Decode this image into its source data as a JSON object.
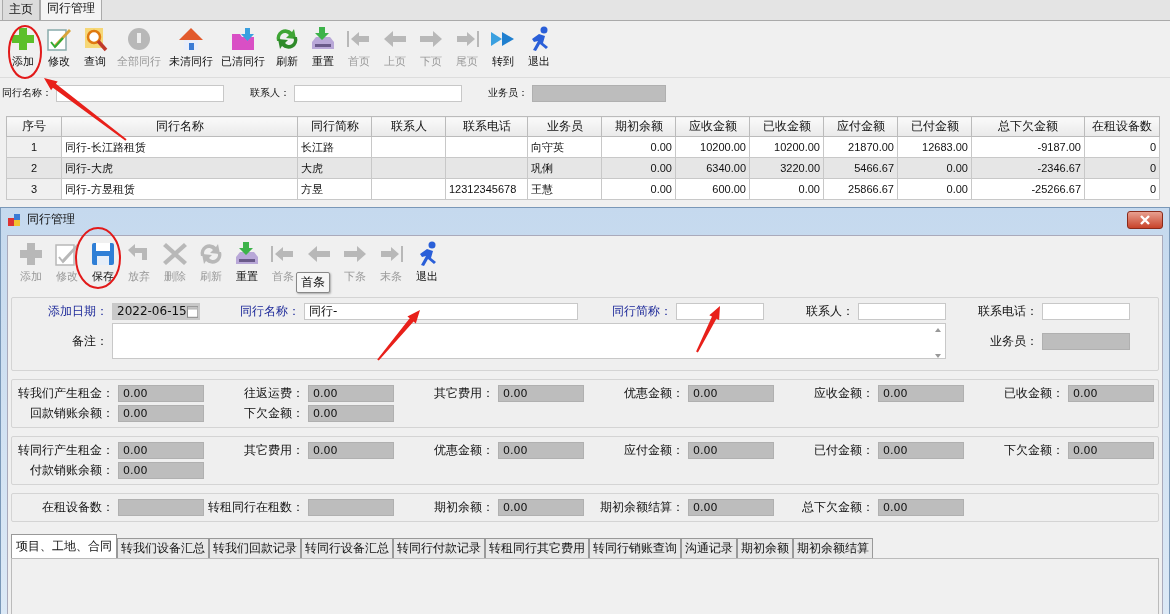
{
  "top_tabs": [
    {
      "label": "主页",
      "selected": false
    },
    {
      "label": "同行管理",
      "selected": true
    }
  ],
  "toolbar": [
    {
      "label": "添加",
      "disabled": false
    },
    {
      "label": "修改",
      "disabled": false
    },
    {
      "label": "查询",
      "disabled": false
    },
    {
      "label": "全部同行",
      "disabled": true
    },
    {
      "label": "未清同行",
      "disabled": false
    },
    {
      "label": "已清同行",
      "disabled": false
    },
    {
      "label": "刷新",
      "disabled": false
    },
    {
      "label": "重置",
      "disabled": false
    },
    {
      "label": "首页",
      "disabled": true
    },
    {
      "label": "上页",
      "disabled": true
    },
    {
      "label": "下页",
      "disabled": true
    },
    {
      "label": "尾页",
      "disabled": true
    },
    {
      "label": "转到",
      "disabled": false
    },
    {
      "label": "退出",
      "disabled": false
    }
  ],
  "filter": [
    {
      "label": "同行名称：",
      "kind": "text"
    },
    {
      "label": "联系人：",
      "kind": "text"
    },
    {
      "label": "业务员：",
      "kind": "readonly"
    }
  ],
  "table": {
    "columns": [
      "序号",
      "同行名称",
      "同行简称",
      "联系人",
      "联系电话",
      "业务员",
      "期初余额",
      "应收金额",
      "已收金额",
      "应付金额",
      "已付金额",
      "总下欠金额",
      "在租设备数"
    ],
    "rows": [
      [
        "1",
        "同行-长江路租赁",
        "长江路",
        null,
        null,
        "向守英",
        "0.00",
        "10200.00",
        "10200.00",
        "21870.00",
        "12683.00",
        "-9187.00",
        "0"
      ],
      [
        "2",
        "同行-大虎",
        "大虎",
        null,
        null,
        "巩俐",
        "0.00",
        "6340.00",
        "3220.00",
        "5466.67",
        "0.00",
        "-2346.67",
        "0"
      ],
      [
        "3",
        "同行-方昱租赁",
        "方昱",
        null,
        "12312345678",
        "王慧",
        "0.00",
        "600.00",
        "0.00",
        "25866.67",
        "0.00",
        "-25266.67",
        "0"
      ]
    ]
  },
  "dialog": {
    "title": "同行管理",
    "toolbar": [
      {
        "label": "添加",
        "disabled": true
      },
      {
        "label": "修改",
        "disabled": true
      },
      {
        "label": "保存",
        "disabled": false
      },
      {
        "label": "放弃",
        "disabled": true
      },
      {
        "label": "删除",
        "disabled": true
      },
      {
        "label": "刷新",
        "disabled": true
      },
      {
        "label": "重置",
        "disabled": false
      },
      {
        "label": "首条",
        "disabled": true
      },
      {
        "disabled": true
      },
      {
        "label": "下条",
        "disabled": true
      },
      {
        "label": "末条",
        "disabled": true
      },
      {
        "label": "退出",
        "disabled": false
      }
    ],
    "tooltip": "首条",
    "form": [
      {
        "label": "添加日期：",
        "required": true,
        "kind": "date",
        "value": "2022-06-15"
      },
      {
        "label": "同行名称：",
        "required": true,
        "kind": "text",
        "value": "同行-"
      },
      {
        "label": "同行简称：",
        "required": true,
        "kind": "text"
      },
      {
        "label": "联系人：",
        "required": false,
        "kind": "text"
      },
      {
        "label": "联系电话：",
        "required": false,
        "kind": "text"
      },
      {
        "label": "备注：",
        "required": false,
        "kind": "memo"
      },
      {
        "label": "业务员：",
        "required": false,
        "kind": "readonly"
      }
    ],
    "groups": [
      [
        {
          "label": "转我们产生租金：",
          "value": "0.00"
        },
        {
          "label": "往返运费：",
          "value": "0.00"
        },
        {
          "label": "其它费用：",
          "value": "0.00"
        },
        {
          "label": "优惠金额：",
          "value": "0.00"
        },
        {
          "label": "应收金额：",
          "value": "0.00"
        },
        {
          "label": "已收金额：",
          "value": "0.00"
        },
        {
          "label": "回款销账余额：",
          "value": "0.00"
        },
        {
          "label": "下欠金额：",
          "value": "0.00"
        }
      ],
      [
        {
          "label": "转同行产生租金：",
          "value": "0.00"
        },
        {
          "label": "其它费用：",
          "value": "0.00"
        },
        {
          "label": "优惠金额：",
          "value": "0.00"
        },
        {
          "label": "应付金额：",
          "value": "0.00"
        },
        {
          "label": "已付金额：",
          "value": "0.00"
        },
        {
          "label": "下欠金额：",
          "value": "0.00"
        },
        {
          "label": "付款销账余额：",
          "value": "0.00"
        }
      ],
      [
        {
          "label": "在租设备数："
        },
        {
          "label": "转租同行在租数："
        },
        {
          "label": "期初余额：",
          "value": "0.00"
        },
        {
          "label": "期初余额结算：",
          "value": "0.00"
        },
        {
          "label": "总下欠金额：",
          "value": "0.00"
        }
      ]
    ],
    "tabs": [
      {
        "label": "项目、工地、合同",
        "selected": true
      },
      {
        "label": "转我们设备汇总",
        "selected": false
      },
      {
        "label": "转我们回款记录",
        "selected": false
      },
      {
        "label": "转同行设备汇总",
        "selected": false
      },
      {
        "label": "转同行付款记录",
        "selected": false
      },
      {
        "label": "转租同行其它费用",
        "selected": false
      },
      {
        "label": "转同行销账查询",
        "selected": false
      },
      {
        "label": "沟通记录",
        "selected": false
      },
      {
        "label": "期初余额",
        "selected": false
      },
      {
        "label": "期初余额结算",
        "selected": false
      }
    ]
  }
}
